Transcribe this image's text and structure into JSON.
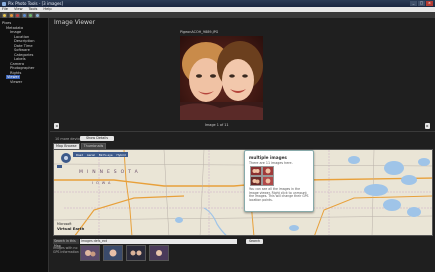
{
  "window": {
    "title": "Pix Photo Tools - [3 images]",
    "buttons": [
      "_",
      "□",
      "×"
    ]
  },
  "menu": [
    "File",
    "View",
    "Tools",
    "Help"
  ],
  "toolbar_icons": [
    "new-icon",
    "open-icon",
    "close-icon",
    "save-icon",
    "refresh-icon",
    "map-icon"
  ],
  "tree": [
    {
      "label": "Pixes",
      "indent": 0
    },
    {
      "label": "Metadata",
      "indent": 1
    },
    {
      "label": "Image",
      "indent": 2
    },
    {
      "label": "Location",
      "indent": 3
    },
    {
      "label": "Description",
      "indent": 3
    },
    {
      "label": "Date Time",
      "indent": 3
    },
    {
      "label": "Software",
      "indent": 3
    },
    {
      "label": "Categories",
      "indent": 3
    },
    {
      "label": "Labels",
      "indent": 3
    },
    {
      "label": "Camera",
      "indent": 2
    },
    {
      "label": "Photographer",
      "indent": 2
    },
    {
      "label": "Rights",
      "indent": 2
    },
    {
      "label": "Viewer",
      "indent": 1,
      "selected": true
    },
    {
      "label": "Viewer",
      "indent": 2
    }
  ],
  "viewer": {
    "title": "Image Viewer",
    "filename": "PigeonACOH_9889.JPG",
    "counter": "Image 1 of 11",
    "prev": "◂",
    "next": "▸"
  },
  "device": {
    "label": "10 more devices",
    "show_button": "Show Details"
  },
  "tabs": [
    "Map Browse",
    "Thumbnails"
  ],
  "map": {
    "state_label": "MINNESOTA",
    "sub_label": "IOWA",
    "controls": [
      "Road",
      "Aerial",
      "Bird's eye",
      "Hybrid"
    ],
    "popup": {
      "title": "multiple images",
      "subtitle": "There are 11 images here.",
      "note": "You can see all the images in the Image viewer. Right click to unmount the images. This will change their GPS location points."
    },
    "brand_line1": "Microsoft",
    "brand_line2": "Virtual Earth"
  },
  "search": {
    "label": "Search in this Map",
    "value": "Images defs_ext",
    "button": "Search"
  },
  "gps_label": "Images with no GPS information",
  "colors": {
    "selected": "#3a63b8",
    "popup_border": "#88aaaa",
    "map_land": "#eae5d6",
    "water": "#9fc4e8"
  }
}
